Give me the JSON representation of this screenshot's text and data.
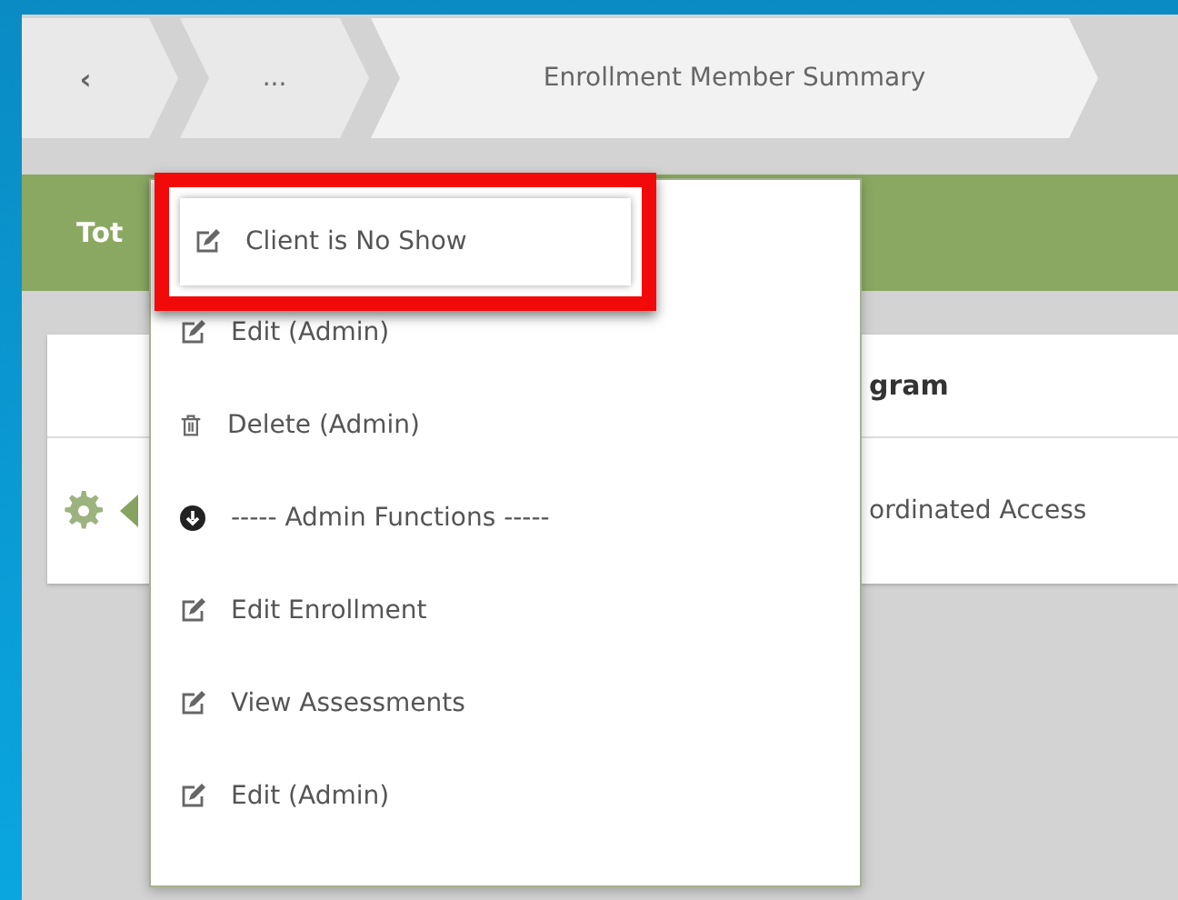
{
  "breadcrumb": [
    {
      "label": "‹",
      "kind": "back"
    },
    {
      "label": "...",
      "kind": "crumb"
    },
    {
      "label": "Enrollment Member Summary",
      "kind": "crumb"
    }
  ],
  "summary_bar": {
    "text": "Tot"
  },
  "table": {
    "columns": [
      "gram"
    ],
    "rows": [
      {
        "cells": [
          "ordinated Access"
        ]
      }
    ]
  },
  "menu": {
    "items": [
      {
        "label": "Client is No Show",
        "kind": "edit",
        "highlighted": true
      },
      {
        "label": "Edit (Admin)",
        "kind": "edit",
        "highlighted": false
      },
      {
        "label": "Delete (Admin)",
        "kind": "delete",
        "highlighted": false
      },
      {
        "label": "----- Admin Functions -----",
        "kind": "section",
        "highlighted": false
      },
      {
        "label": "Edit Enrollment",
        "kind": "edit",
        "highlighted": false
      },
      {
        "label": "View Assessments",
        "kind": "edit",
        "highlighted": false
      },
      {
        "label": "Edit (Admin)",
        "kind": "edit",
        "highlighted": false
      }
    ]
  }
}
